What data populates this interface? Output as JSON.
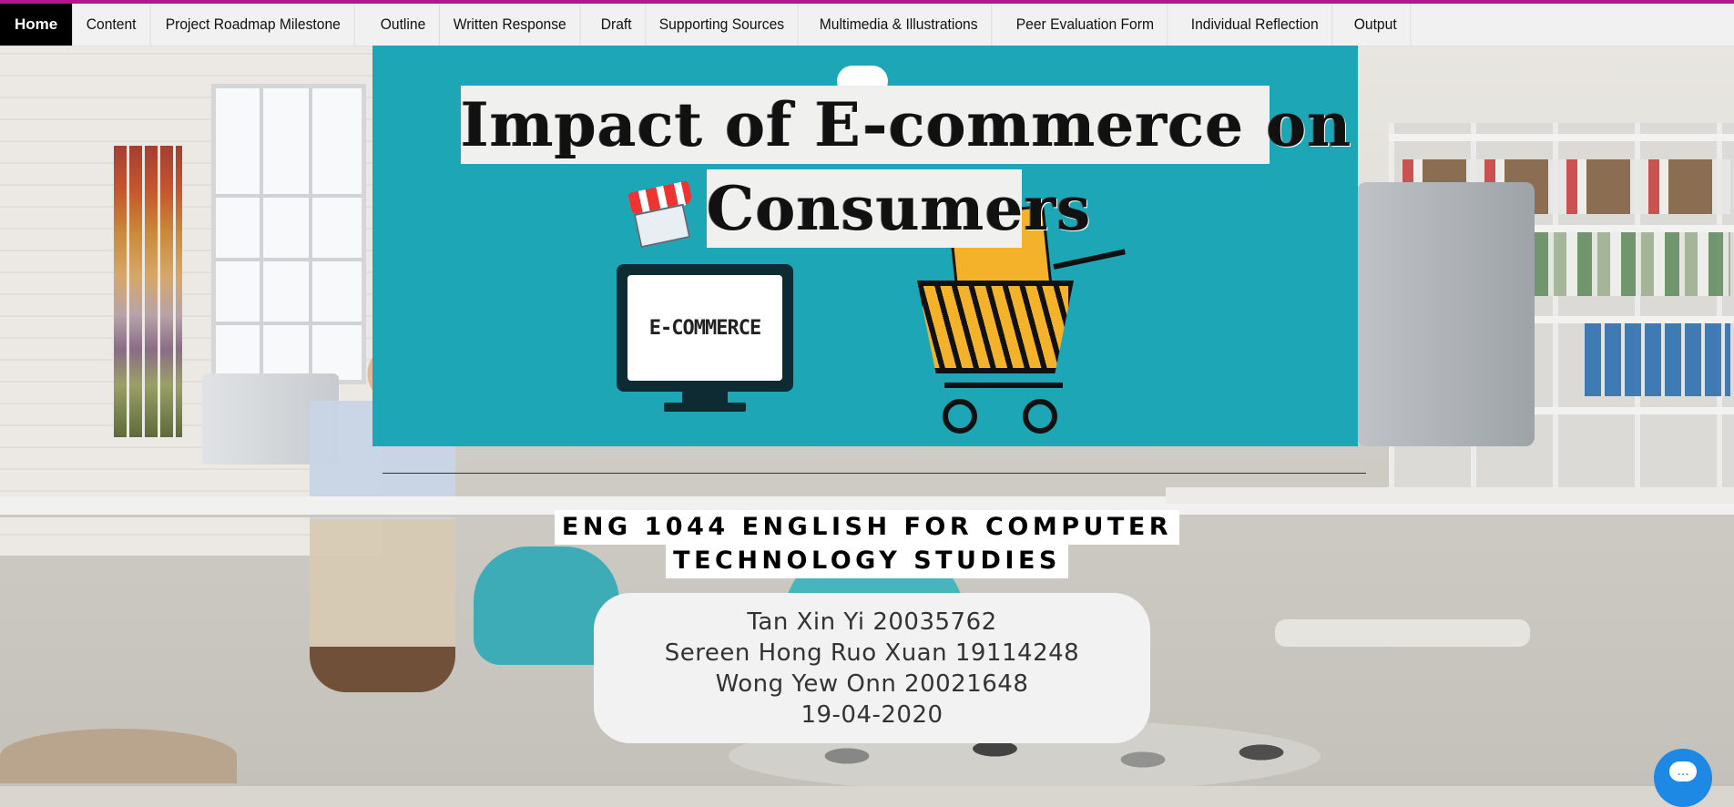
{
  "nav": {
    "items": [
      {
        "label": "Home",
        "active": true
      },
      {
        "label": "Content"
      },
      {
        "label": "Project Roadmap Milestone"
      },
      {
        "label": "Outline"
      },
      {
        "label": "Written Response"
      },
      {
        "label": "Draft"
      },
      {
        "label": "Supporting Sources"
      },
      {
        "label": "Multimedia & Illustrations"
      },
      {
        "label": "Peer Evaluation Form"
      },
      {
        "label": "Individual Reflection"
      },
      {
        "label": "Output"
      }
    ]
  },
  "banner": {
    "title_line1": "Impact  of  E-commerce on",
    "title_line2": "Consumers",
    "monitor_text": "E-COMMERCE",
    "background_color": "#1ca6b6"
  },
  "course": {
    "line1": "ENG 1044 ENGLISH FOR COMPUTER",
    "line2": "TECHNOLOGY STUDIES"
  },
  "authors": [
    "Tan Xin Yi 20035762",
    "Sereen Hong Ruo Xuan 19114248",
    "Wong Yew Onn 20021648",
    "19-04-2020"
  ],
  "chat": {
    "icon": "chat-bubble-icon",
    "glyph": "..."
  },
  "colors": {
    "accent": "#b0188e",
    "nav_active": "#000000",
    "chat": "#1e88e5"
  }
}
